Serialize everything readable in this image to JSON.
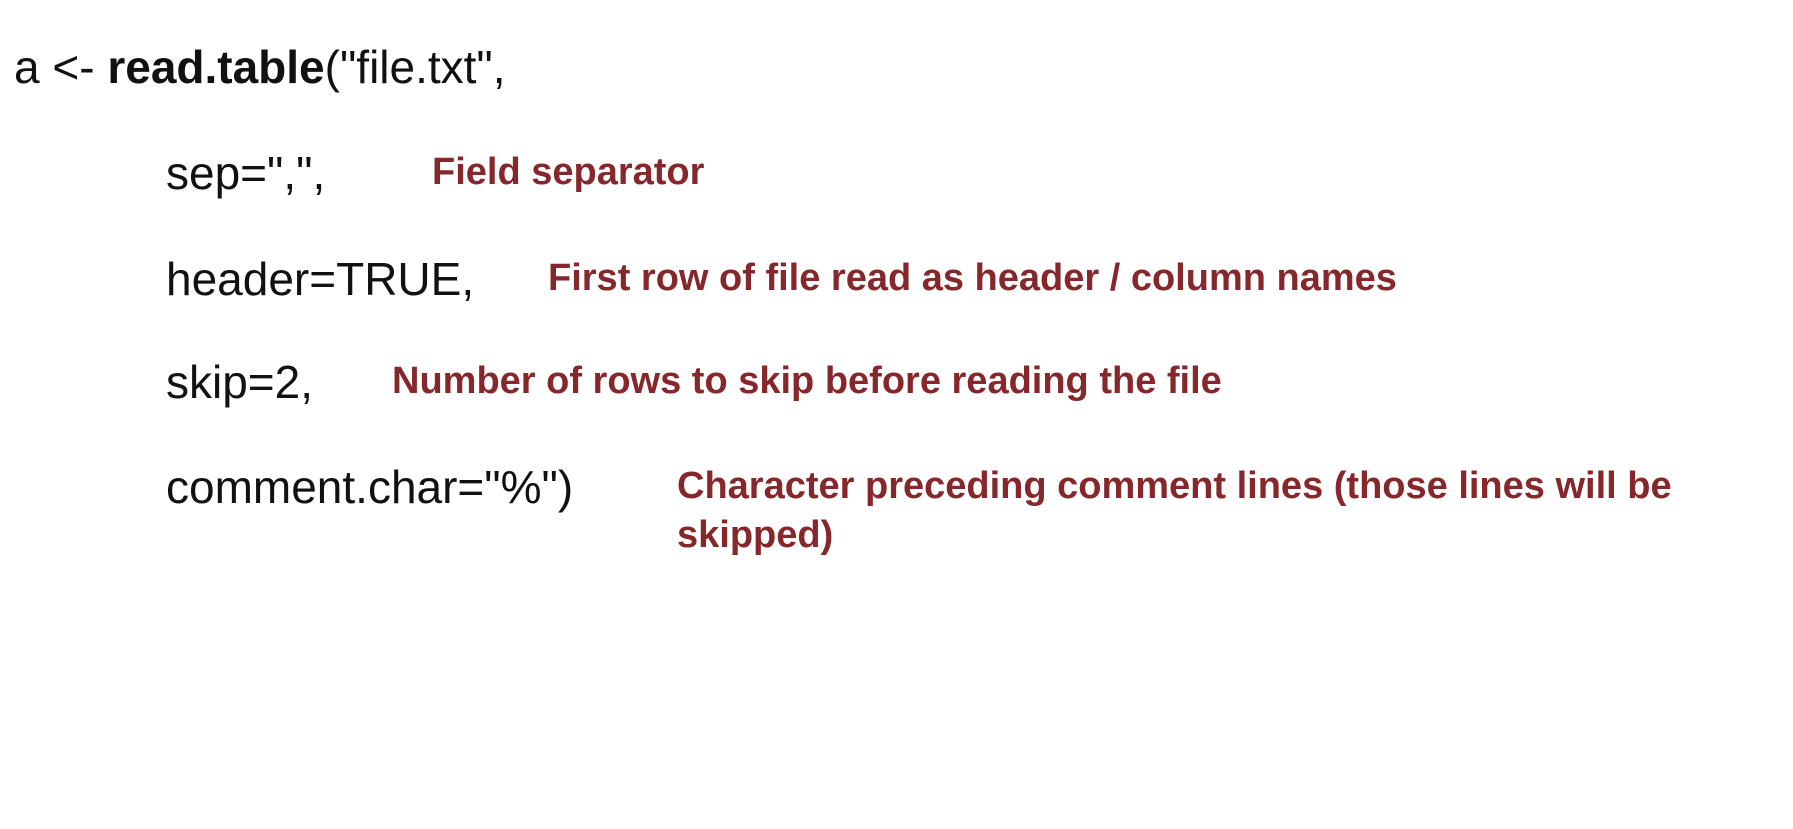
{
  "code": {
    "main_prefix": "a <- ",
    "main_function": "read.table",
    "main_suffix": "(\"file.txt\",",
    "sep": "sep=\",\",",
    "header": "header=TRUE,",
    "skip": "skip=2,",
    "comment": "comment.char=\"%\")"
  },
  "notes": {
    "sep": "Field separator",
    "header": "First row of file read as header / column names",
    "skip": "Number of rows to skip before reading the file",
    "comment": "Character preceding comment lines (those lines will be skipped)"
  },
  "colors": {
    "code_text": "#111111",
    "annotation_text": "#86282b",
    "background": "#ffffff"
  }
}
